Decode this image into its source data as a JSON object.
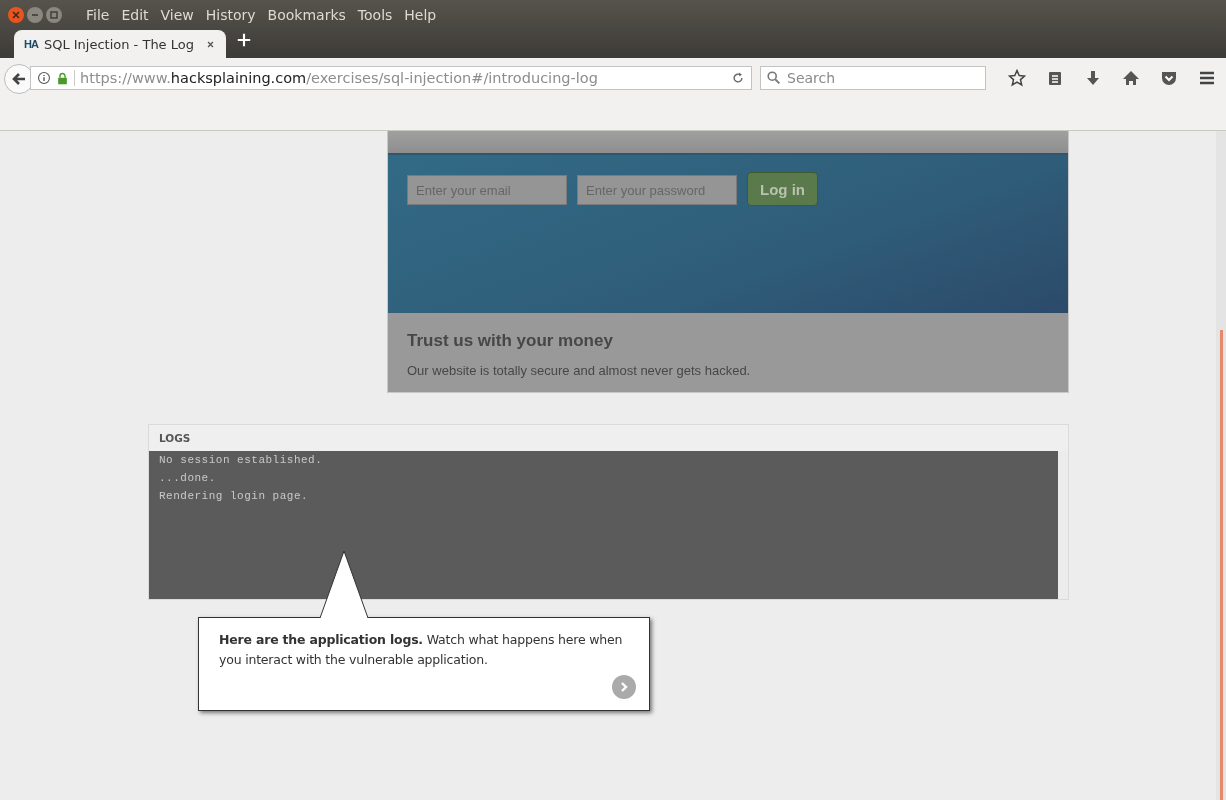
{
  "menu": [
    "File",
    "Edit",
    "View",
    "History",
    "Bookmarks",
    "Tools",
    "Help"
  ],
  "tabs": [
    {
      "favicon": "HA",
      "title": "SQL Injection - The Log",
      "selected": true
    }
  ],
  "url": {
    "scheme": "https://www.",
    "host": "hacksplaining.com",
    "path": "/exercises/sql-injection#/introducing-log"
  },
  "search": {
    "placeholder": "Search"
  },
  "app": {
    "email_placeholder": "Enter your email",
    "password_placeholder": "Enter your password",
    "login_button": "Log in",
    "heading": "Trust us with your money",
    "tagline": "Our website is totally secure and almost never gets hacked."
  },
  "logs": {
    "title": "LOGS",
    "lines": [
      "No session established.",
      "...done.",
      "Rendering login page."
    ]
  },
  "tooltip": {
    "text": "**Here are the application logs.** Watch what happens here when you interact with the vulnerable application."
  }
}
